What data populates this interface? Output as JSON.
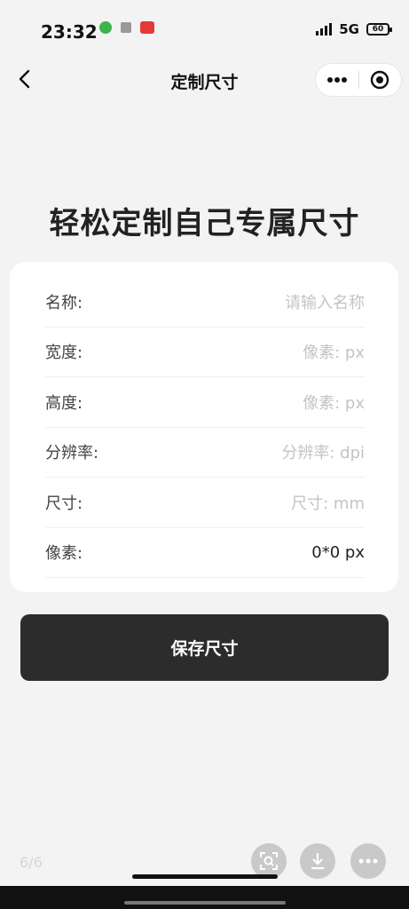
{
  "status_bar": {
    "time": "23:32",
    "network": "5G",
    "battery": "60"
  },
  "nav": {
    "title": "定制尺寸"
  },
  "hero": {
    "title": "轻松定制自己专属尺寸"
  },
  "form": {
    "rows": [
      {
        "label": "名称:",
        "placeholder": "请输入名称",
        "value": ""
      },
      {
        "label": "宽度:",
        "placeholder": "像素: px",
        "value": ""
      },
      {
        "label": "高度:",
        "placeholder": "像素: px",
        "value": ""
      },
      {
        "label": "分辨率:",
        "placeholder": "分辨率: dpi",
        "value": ""
      },
      {
        "label": "尺寸:",
        "placeholder": "尺寸: mm",
        "value": ""
      },
      {
        "label": "像素:",
        "placeholder": "",
        "value": "0*0 px"
      }
    ]
  },
  "actions": {
    "save_label": "保存尺寸"
  },
  "viewer": {
    "page_counter": "6/6"
  },
  "colors": {
    "background": "#f3f3f3",
    "button": "#2c2c2c",
    "placeholder": "#c4c4c4"
  }
}
